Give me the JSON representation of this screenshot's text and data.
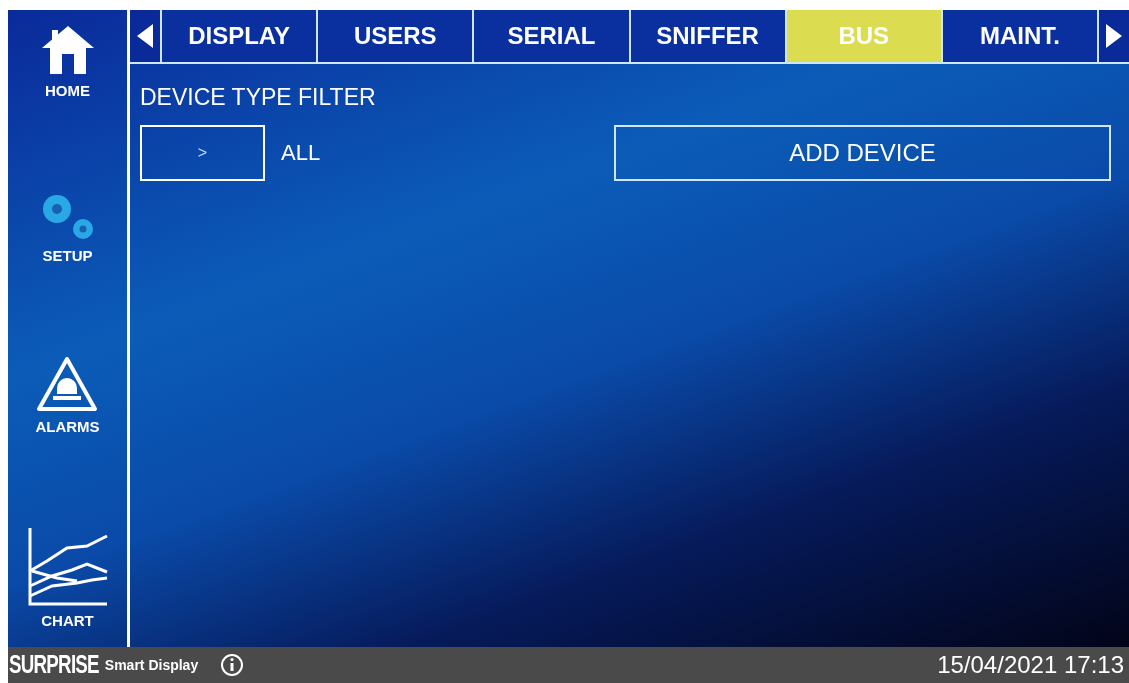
{
  "sidebar": {
    "items": [
      {
        "kind": "home",
        "label": "HOME"
      },
      {
        "kind": "setup",
        "label": "SETUP"
      },
      {
        "kind": "alarms",
        "label": "ALARMS"
      },
      {
        "kind": "chart",
        "label": "CHART"
      }
    ]
  },
  "tabs": [
    {
      "label": "DISPLAY",
      "selected": false
    },
    {
      "label": "USERS",
      "selected": false
    },
    {
      "label": "SERIAL",
      "selected": false
    },
    {
      "label": "SNIFFER",
      "selected": false
    },
    {
      "label": "BUS",
      "selected": true
    },
    {
      "label": "MAINT.",
      "selected": false
    }
  ],
  "filter": {
    "title": "DEVICE TYPE FILTER",
    "button": ">",
    "value": "ALL"
  },
  "add_button": "ADD DEVICE",
  "status_bar": {
    "brand": "SURPRISE",
    "product": "Smart Display",
    "datetime": "15/04/2021 17:13"
  }
}
